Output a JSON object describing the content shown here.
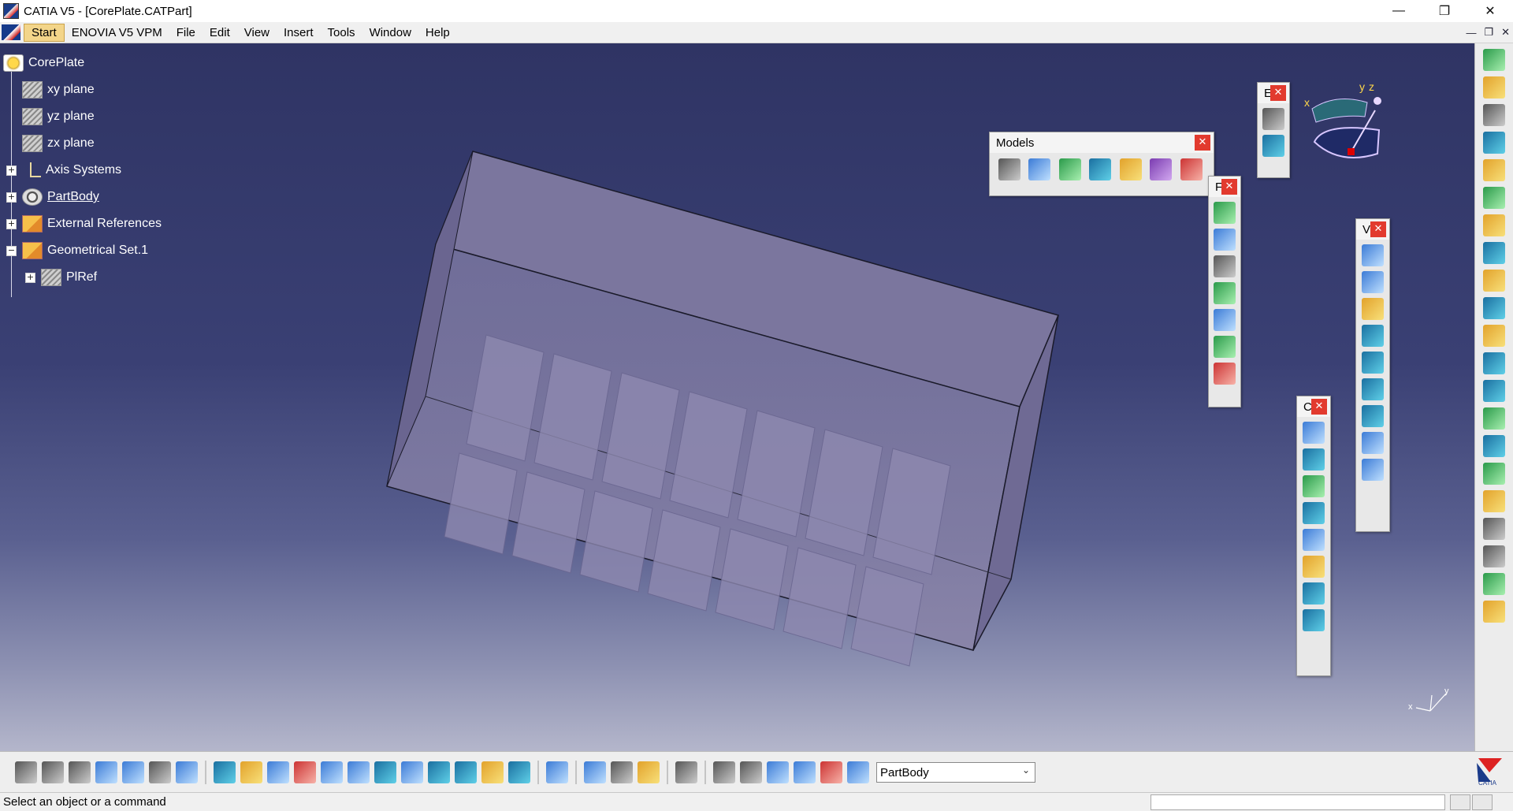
{
  "window": {
    "title": "CATIA V5 - [CorePlate.CATPart]",
    "minimize_icon": "minimize-icon",
    "maximize_icon": "restore-icon",
    "close_icon": "close-icon"
  },
  "menu": {
    "items": [
      "Start",
      "ENOVIA V5 VPM",
      "File",
      "Edit",
      "View",
      "Insert",
      "Tools",
      "Window",
      "Help"
    ]
  },
  "tree": {
    "root": "CorePlate",
    "items": [
      {
        "label": "xy plane",
        "icon": "plane-icon"
      },
      {
        "label": "yz plane",
        "icon": "plane-icon"
      },
      {
        "label": "zx plane",
        "icon": "plane-icon"
      },
      {
        "label": "Axis Systems",
        "icon": "axis-system-icon"
      },
      {
        "label": "PartBody",
        "icon": "part-body-icon"
      },
      {
        "label": "External References",
        "icon": "external-references-icon"
      },
      {
        "label": "Geometrical Set.1",
        "icon": "geometrical-set-icon"
      },
      {
        "label": "PlRef",
        "icon": "plane-icon"
      }
    ]
  },
  "toolbars": {
    "models": {
      "title": "Models"
    },
    "small_e": {
      "title": "E"
    },
    "small_f": {
      "title": "F"
    },
    "small_v": {
      "title": "V"
    },
    "small_c": {
      "title": "C"
    }
  },
  "compass": {
    "x": "x",
    "y": "y",
    "z": "z"
  },
  "axis_triad": {
    "x": "x",
    "y": "y"
  },
  "bottom": {
    "current_body": "PartBody"
  },
  "status": {
    "message": "Select an object or a command"
  },
  "colors": {
    "viewport_top": "#2f3464",
    "viewport_bottom": "#b4b6cb",
    "part_fill": "#6e6a96",
    "close_button": "#e23a2e"
  }
}
